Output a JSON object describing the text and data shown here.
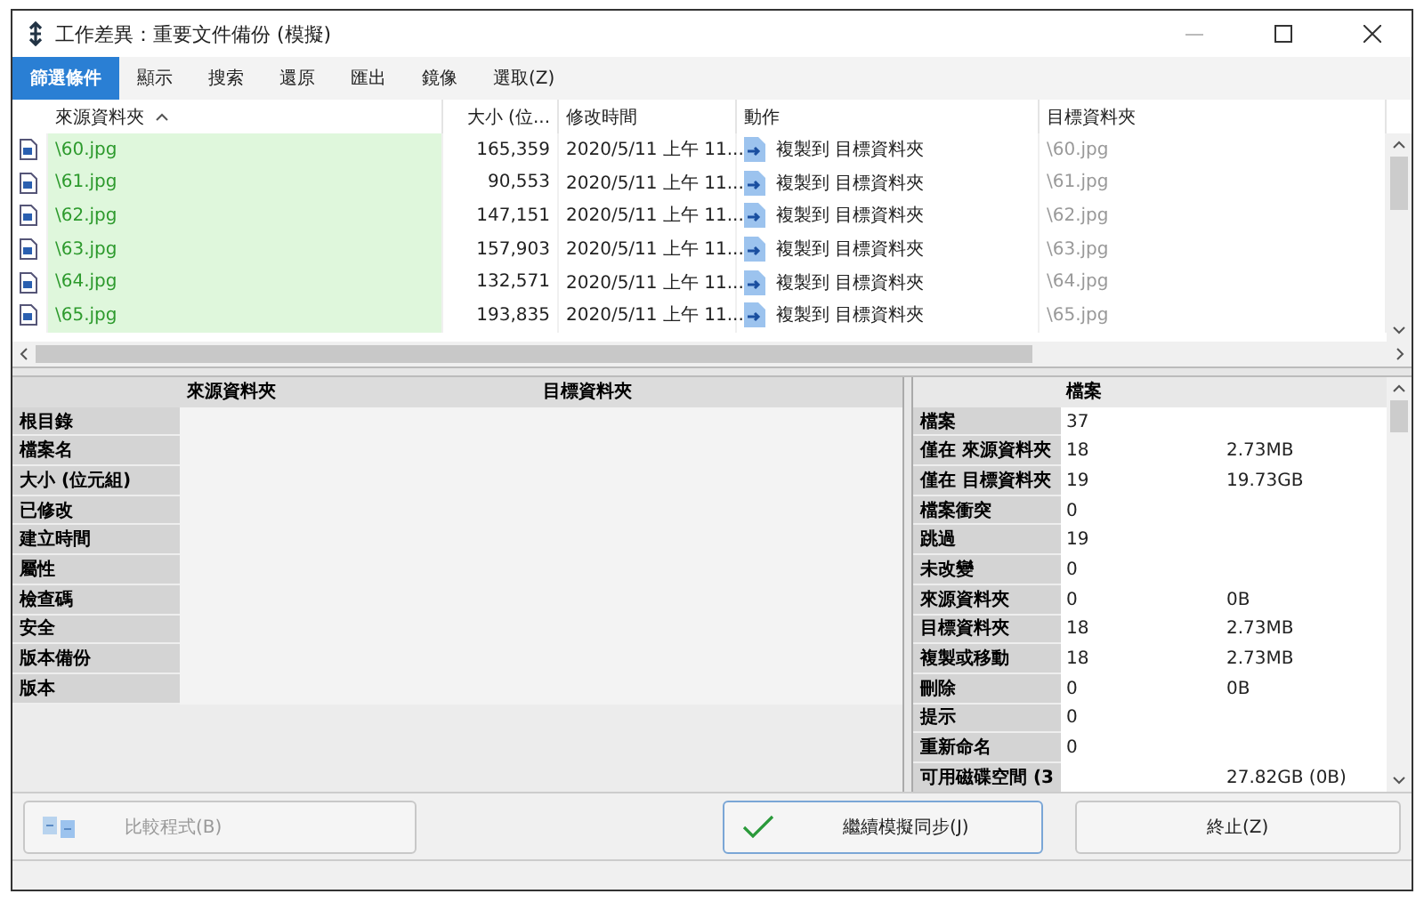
{
  "window": {
    "title": "工作差異：重要文件備份 (模擬)"
  },
  "menu": [
    {
      "label": "篩選條件",
      "selected": true
    },
    {
      "label": "顯示",
      "selected": false
    },
    {
      "label": "搜索",
      "selected": false
    },
    {
      "label": "還原",
      "selected": false
    },
    {
      "label": "匯出",
      "selected": false
    },
    {
      "label": "鏡像",
      "selected": false
    },
    {
      "label": "選取(Z)",
      "selected": false
    }
  ],
  "file_list": {
    "columns": [
      "來源資料夾",
      "大小 (位...",
      "修改時間",
      "動作",
      "目標資料夾"
    ],
    "rows": [
      {
        "source": "\\60.jpg",
        "size": "165,359",
        "modified": "2020/5/11 上午 11...",
        "action": "複製到 目標資料夾",
        "target": "\\60.jpg"
      },
      {
        "source": "\\61.jpg",
        "size": "90,553",
        "modified": "2020/5/11 上午 11...",
        "action": "複製到 目標資料夾",
        "target": "\\61.jpg"
      },
      {
        "source": "\\62.jpg",
        "size": "147,151",
        "modified": "2020/5/11 上午 11...",
        "action": "複製到 目標資料夾",
        "target": "\\62.jpg"
      },
      {
        "source": "\\63.jpg",
        "size": "157,903",
        "modified": "2020/5/11 上午 11...",
        "action": "複製到 目標資料夾",
        "target": "\\63.jpg"
      },
      {
        "source": "\\64.jpg",
        "size": "132,571",
        "modified": "2020/5/11 上午 11...",
        "action": "複製到 目標資料夾",
        "target": "\\64.jpg"
      },
      {
        "source": "\\65.jpg",
        "size": "193,835",
        "modified": "2020/5/11 上午 11...",
        "action": "複製到 目標資料夾",
        "target": "\\65.jpg"
      }
    ]
  },
  "details": {
    "columns": [
      "來源資料夾",
      "目標資料夾"
    ],
    "rows": [
      "根目錄",
      "檔案名",
      "大小 (位元組)",
      "已修改",
      "建立時間",
      "屬性",
      "檢查碼",
      "安全",
      "版本備份",
      "版本"
    ]
  },
  "stats": {
    "header": "檔案",
    "rows": [
      {
        "label": "檔案",
        "count": "37"
      },
      {
        "label": "僅在 來源資料夾",
        "count": "18",
        "size": "2.73MB"
      },
      {
        "label": "僅在 目標資料夾",
        "count": "19",
        "size": "19.73GB"
      },
      {
        "label": "檔案衝突",
        "count": "0"
      },
      {
        "label": "跳過",
        "count": "19"
      },
      {
        "label": "未改變",
        "count": "0"
      },
      {
        "label": "來源資料夾",
        "count": "0",
        "size": "0B"
      },
      {
        "label": "目標資料夾",
        "count": "18",
        "size": "2.73MB"
      },
      {
        "label": "複製或移動",
        "count": "18",
        "size": "2.73MB"
      },
      {
        "label": "刪除",
        "count": "0",
        "size": "0B"
      },
      {
        "label": "提示",
        "count": "0"
      },
      {
        "label": "重新命名",
        "count": "0"
      },
      {
        "label": "可用磁碟空間 (3",
        "size": "27.82GB (0B)"
      }
    ]
  },
  "buttons": [
    {
      "label": "比較程式(B)",
      "kind": "compare",
      "disabled": true
    },
    {
      "label": "繼續模擬同步(J)",
      "kind": "continue",
      "disabled": false
    },
    {
      "label": "終止(Z)",
      "kind": "stop",
      "disabled": false
    }
  ]
}
